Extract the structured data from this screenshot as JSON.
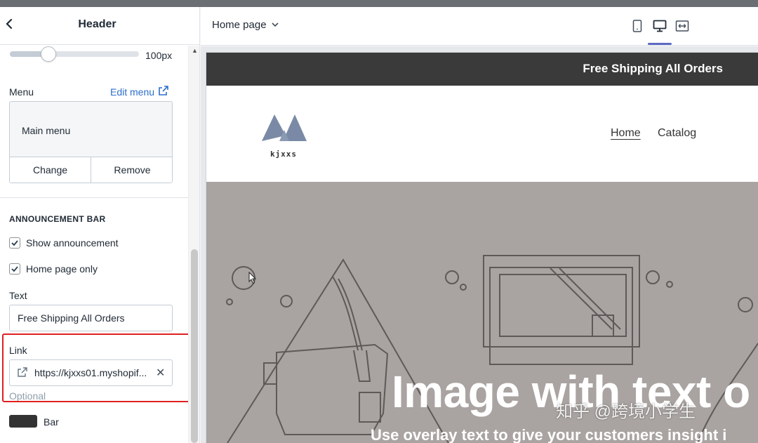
{
  "sidebar": {
    "title": "Header",
    "logo_width_value": "100px",
    "logo_width_fraction": 0.27,
    "menu": {
      "label": "Menu",
      "edit_label": "Edit menu",
      "selected": "Main menu",
      "change_label": "Change",
      "remove_label": "Remove"
    },
    "announcement": {
      "section_title": "ANNOUNCEMENT BAR",
      "show_label": "Show announcement",
      "show_checked": true,
      "home_only_label": "Home page only",
      "home_only_checked": true,
      "text_label": "Text",
      "text_value": "Free Shipping All Orders",
      "link_label": "Link",
      "link_value": "https://kjxxs01.myshopif...",
      "link_hint": "Optional",
      "bar_color_label": "Bar",
      "bar_color": "#333333"
    }
  },
  "toolbar": {
    "page_select": "Home page",
    "devices": [
      "mobile-icon",
      "desktop-icon",
      "fullscreen-icon"
    ],
    "active_device": "desktop-icon"
  },
  "preview": {
    "announcement_text": "Free Shipping All Orders",
    "logo_text": "kjxxs",
    "nav": [
      "Home",
      "Catalog"
    ],
    "hero_title": "Image with text o",
    "hero_subtitle": "Use overlay text to give your customers insight i"
  },
  "watermark": "知乎 @跨境小学生",
  "colors": {
    "accent": "#5c6ac4",
    "link": "#2c6ecb",
    "highlight": "#e02020",
    "hero_bg": "#a9a3a1"
  }
}
